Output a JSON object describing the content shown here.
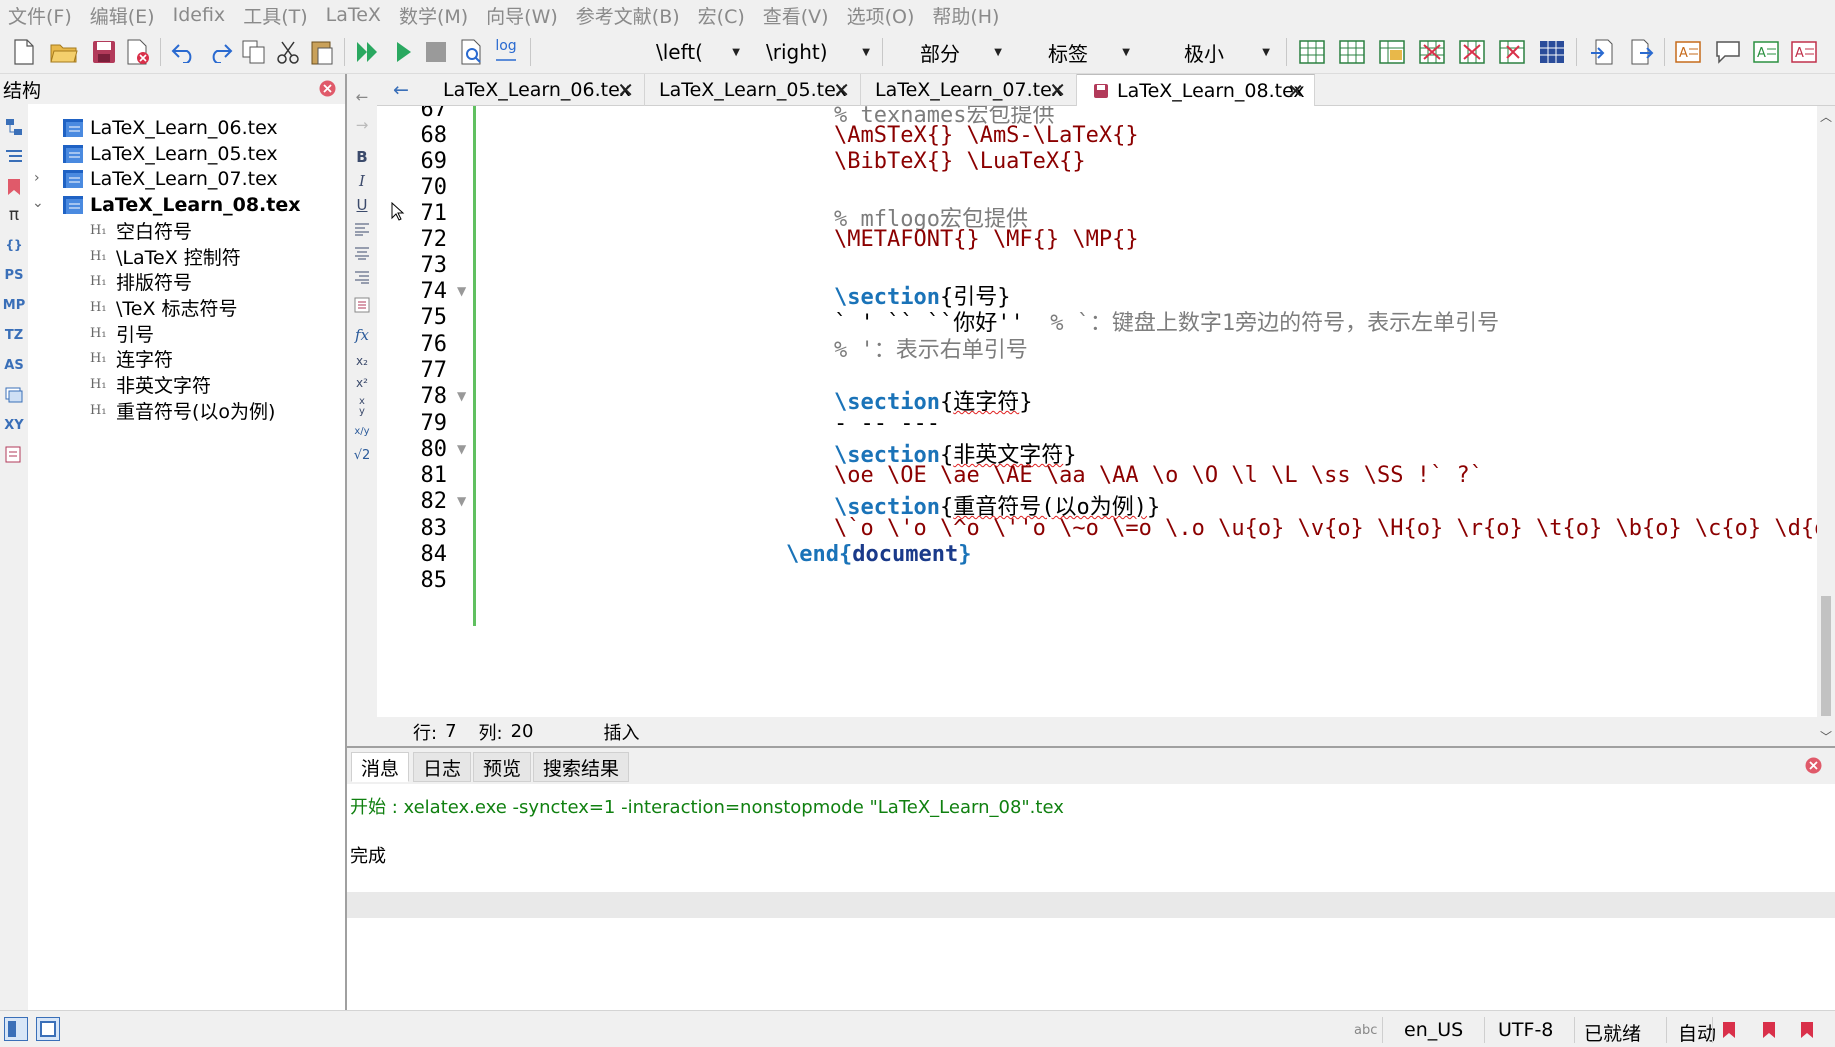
{
  "menu": [
    "文件(F)",
    "编辑(E)",
    "Idefix",
    "工具(T)",
    "LaTeX",
    "数学(M)",
    "向导(W)",
    "参考文献(B)",
    "宏(C)",
    "查看(V)",
    "选项(O)",
    "帮助(H)"
  ],
  "toolbar": {
    "left_delim": "\\left(",
    "right_delim": "\\right)",
    "section_combo": "部分",
    "label_combo": "标签",
    "size_combo": "极小",
    "log_label": "log"
  },
  "structure": {
    "title": "结构",
    "files": [
      "LaTeX_Learn_06.tex",
      "LaTeX_Learn_05.tex",
      "LaTeX_Learn_07.tex",
      "LaTeX_Learn_08.tex"
    ],
    "sections": [
      "空白符号",
      "\\LaTeX 控制符",
      "排版符号",
      "\\TeX 标志符号",
      "引号",
      "连字符",
      "非英文字符",
      "重音符号(以o为例)"
    ]
  },
  "side_icons": [
    "PS",
    "MP",
    "TZ",
    "AS",
    "XY"
  ],
  "tabs": [
    "LaTeX_Learn_06.tex",
    "LaTeX_Learn_05.tex",
    "LaTeX_Learn_07.tex",
    "LaTeX_Learn_08.tex"
  ],
  "editor": {
    "line_numbers": [
      "67",
      "68",
      "69",
      "70",
      "71",
      "72",
      "73",
      "74",
      "75",
      "76",
      "77",
      "78",
      "79",
      "80",
      "81",
      "82",
      "83",
      "84",
      "85"
    ],
    "lines": {
      "l67": "% texnames宏包提供",
      "l68": "\\AmSTeX{} \\AmS-\\LaTeX{}",
      "l69": "\\BibTeX{} \\LuaTeX{}",
      "l71": "% mflogo宏包提供",
      "l72": "\\METAFONT{} \\MF{} \\MP{}",
      "l74_kw": "\\section",
      "l74_arg": "引号",
      "l75_code": "` ' `` ``你好'' ",
      "l75_cmt": " % `：键盘上数字1旁边的符号，表示左单引号",
      "l76": "% '：表示右单引号",
      "l78_kw": "\\section",
      "l78_arg": "连字符",
      "l79": "- -- ---",
      "l80_kw": "\\section",
      "l80_arg": "非英文字符",
      "l81": "\\oe \\OE \\ae \\AE \\aa \\AA \\o \\O \\l \\L \\ss \\SS !` ?`",
      "l82_kw": "\\section",
      "l82_arg": "重音符号(以o为例)",
      "l83": "\\`o \\'o \\^o \\''o \\~o \\=o \\.o \\u{o} \\v{o} \\H{o} \\r{o} \\t{o} \\b{o} \\c{o} \\d{o}",
      "l84_kw": "\\end",
      "l84_arg": "document"
    }
  },
  "editor_status": {
    "row_label": "行:",
    "row_value": "7",
    "col_label": "列:",
    "col_value": "20",
    "mode": "插入"
  },
  "messages": {
    "tabs": [
      "消息",
      "日志",
      "预览",
      "搜索结果"
    ],
    "start_line": "开始 : xelatex.exe -synctex=1 -interaction=nonstopmode \"LaTeX_Learn_08\".tex",
    "done_line": "完成"
  },
  "statusbar": {
    "language": "en_US",
    "encoding": "UTF-8",
    "state": "已就绪",
    "mode": "自动"
  }
}
